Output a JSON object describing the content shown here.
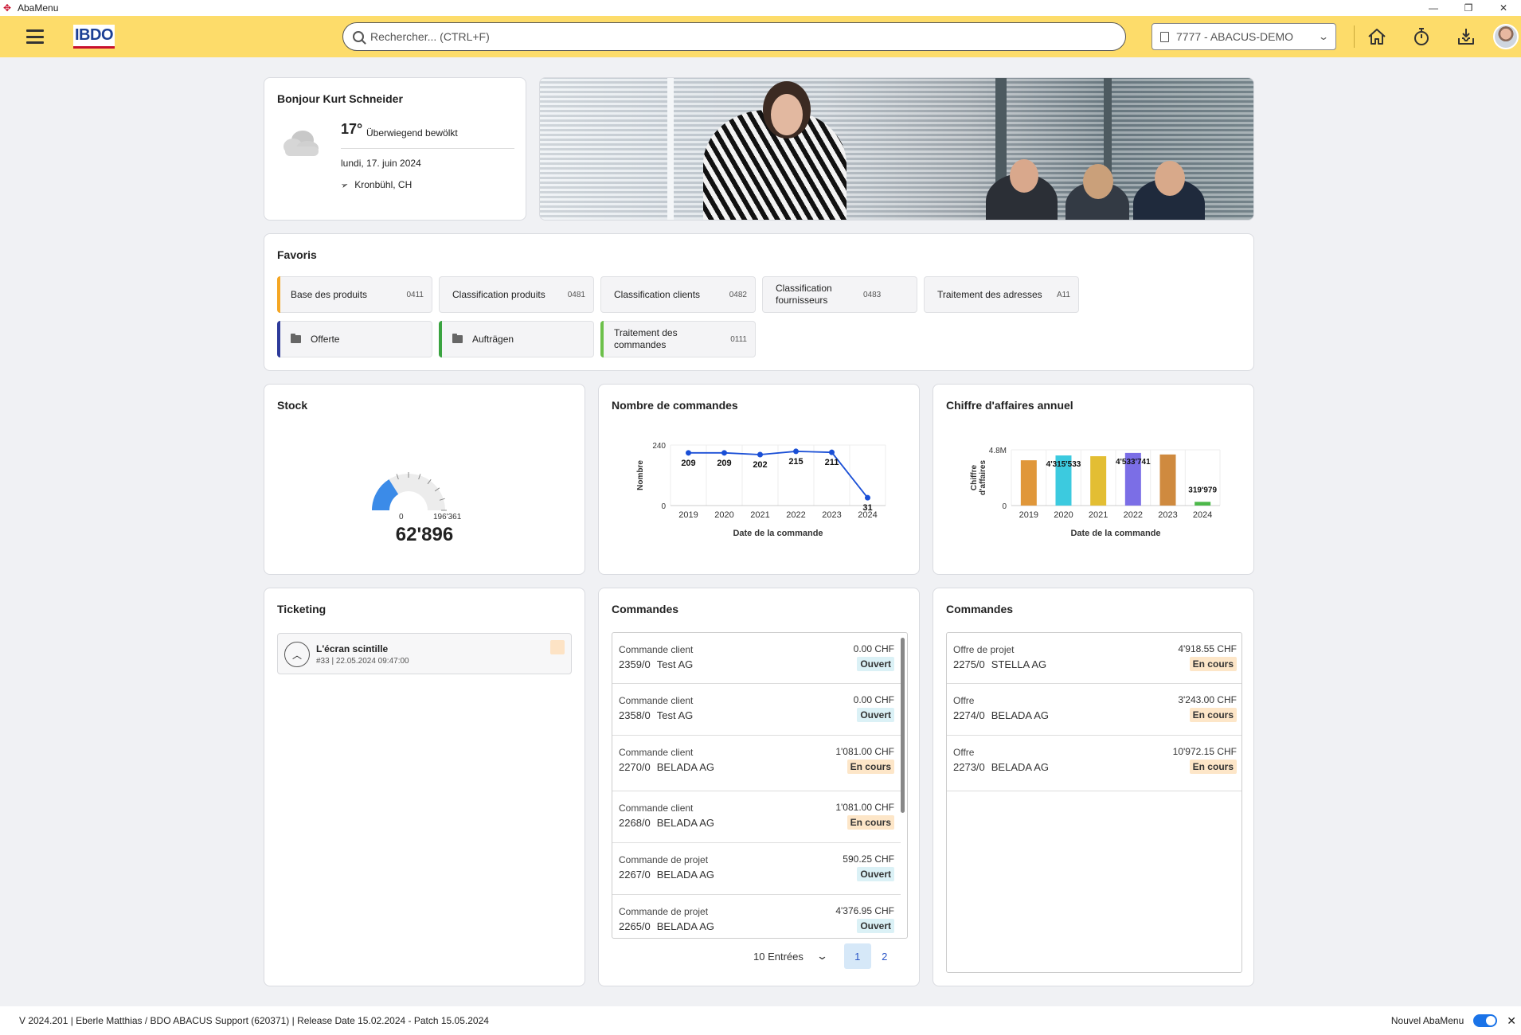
{
  "window": {
    "title": "AbaMenu"
  },
  "header": {
    "search_placeholder": "Rechercher... (CTRL+F)",
    "mandant": "7777 - ABACUS-DEMO",
    "logo_text": "IBDO"
  },
  "greeting": {
    "title": "Bonjour Kurt Schneider",
    "temp": "17°",
    "condition": "Überwiegend bewölkt",
    "date": "lundi, 17. juin 2024",
    "location": "Kronbühl, CH"
  },
  "favorites": {
    "title": "Favoris",
    "items": [
      {
        "label": "Base des produits",
        "code": "0411",
        "accent": "#f5a623",
        "folder": false
      },
      {
        "label": "Classification produits",
        "code": "0481",
        "accent": "",
        "folder": false
      },
      {
        "label": "Classification clients",
        "code": "0482",
        "accent": "",
        "folder": false
      },
      {
        "label": "Classification fournisseurs",
        "code": "0483",
        "accent": "",
        "folder": false
      },
      {
        "label": "Traitement des adresses",
        "code": "A11",
        "accent": "",
        "folder": false
      },
      {
        "label": "Offerte",
        "code": "",
        "accent": "#2d3a9a",
        "folder": true
      },
      {
        "label": "Aufträgen",
        "code": "",
        "accent": "#3aa340",
        "folder": true
      },
      {
        "label": "Traitement des commandes",
        "code": "0111",
        "accent": "#6cc04a",
        "folder": false
      }
    ]
  },
  "stock": {
    "title": "Stock",
    "min_label": "0",
    "max_label": "196'361",
    "value_label": "62'896",
    "value": 62896,
    "max": 196361,
    "color": "#3b8be8"
  },
  "orders_count": {
    "title": "Nombre de commandes"
  },
  "revenue": {
    "title": "Chiffre d'affaires annuel"
  },
  "chart_data": [
    {
      "type": "line",
      "title": "Nombre de commandes",
      "xlabel": "Date de la commande",
      "ylabel": "Nombre",
      "categories": [
        "2019",
        "2020",
        "2021",
        "2022",
        "2023",
        "2024"
      ],
      "values": [
        209,
        209,
        202,
        215,
        211,
        31
      ],
      "ylim": [
        0,
        240
      ],
      "yticks": [
        "0",
        "240"
      ],
      "color": "#1a4fd6",
      "grid": true
    },
    {
      "type": "bar",
      "title": "Chiffre d'affaires annuel",
      "xlabel": "Date de la commande",
      "ylabel": "Chiffre d'affaires",
      "categories": [
        "2019",
        "2020",
        "2021",
        "2022",
        "2023",
        "2024"
      ],
      "values": [
        3900000,
        4315533,
        4250000,
        4533741,
        4400000,
        319979
      ],
      "data_labels": [
        "",
        "4'315'533",
        "",
        "4'533'741",
        "",
        "319'979"
      ],
      "colors": [
        "#e0973a",
        "#3ccadf",
        "#e3be33",
        "#7b6ee6",
        "#cf8a3f",
        "#4cb84a"
      ],
      "ylim": [
        0,
        4800000
      ],
      "yticks": [
        "0",
        "4.8M"
      ],
      "grid": true
    }
  ],
  "ticketing": {
    "title": "Ticketing",
    "ticket_title": "L'écran scintille",
    "ticket_meta": "#33 | 22.05.2024 09:47:00"
  },
  "orders": {
    "title": "Commandes",
    "rows": [
      {
        "type": "Commande client",
        "num": "2359/0",
        "cust": "Test AG",
        "amount": "0.00 CHF",
        "status": "Ouvert",
        "kind": "open"
      },
      {
        "type": "Commande client",
        "num": "2358/0",
        "cust": "Test AG",
        "amount": "0.00 CHF",
        "status": "Ouvert",
        "kind": "open"
      },
      {
        "type": "Commande client",
        "num": "2270/0",
        "cust": "BELADA AG",
        "amount": "1'081.00 CHF",
        "status": "En cours",
        "kind": "prog"
      },
      {
        "type": "Commande client",
        "num": "2268/0",
        "cust": "BELADA AG",
        "amount": "1'081.00 CHF",
        "status": "En cours",
        "kind": "prog"
      },
      {
        "type": "Commande de projet",
        "num": "2267/0",
        "cust": "BELADA AG",
        "amount": "590.25 CHF",
        "status": "Ouvert",
        "kind": "open"
      },
      {
        "type": "Commande de projet",
        "num": "2265/0",
        "cust": "BELADA AG",
        "amount": "4'376.95 CHF",
        "status": "Ouvert",
        "kind": "open"
      }
    ],
    "entries_label": "10 Entrées",
    "pages": [
      "1",
      "2"
    ]
  },
  "offers": {
    "title": "Commandes",
    "rows": [
      {
        "type": "Offre de projet",
        "num": "2275/0",
        "cust": "STELLA AG",
        "amount": "4'918.55 CHF",
        "status": "En cours",
        "kind": "prog"
      },
      {
        "type": "Offre",
        "num": "2274/0",
        "cust": "BELADA AG",
        "amount": "3'243.00 CHF",
        "status": "En cours",
        "kind": "prog"
      },
      {
        "type": "Offre",
        "num": "2273/0",
        "cust": "BELADA AG",
        "amount": "10'972.15 CHF",
        "status": "En cours",
        "kind": "prog"
      }
    ]
  },
  "footer": {
    "version": "V 2024.201 | Eberle Matthias / BDO ABACUS Support (620371) | Release Date 15.02.2024 - Patch 15.05.2024",
    "toggle_label": "Nouvel AbaMenu"
  }
}
